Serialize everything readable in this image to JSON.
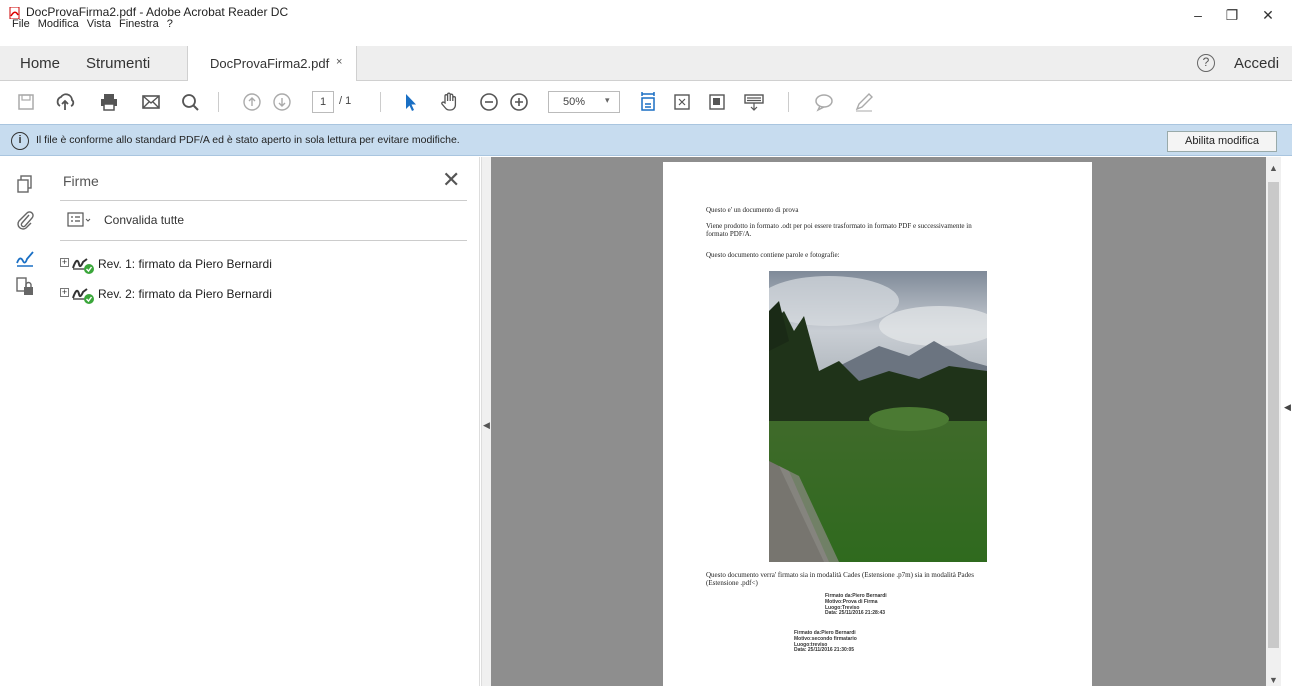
{
  "window": {
    "title": "DocProvaFirma2.pdf - Adobe Acrobat Reader DC",
    "menu": [
      "File",
      "Modifica",
      "Vista",
      "Finestra",
      "?"
    ],
    "minimize_glyph": "–",
    "maximize_glyph": "❐",
    "close_glyph": "✕"
  },
  "tabs": {
    "home": "Home",
    "tools": "Strumenti",
    "document": "DocProvaFirma2.pdf",
    "document_close": "×",
    "help": "?",
    "login": "Accedi"
  },
  "toolbar": {
    "page_current": "1",
    "page_total": "/ 1",
    "zoom": "50%",
    "icons": [
      "save-icon",
      "upload-icon",
      "print-icon",
      "email-icon",
      "search-icon",
      "page-up-icon",
      "page-down-icon",
      "select-cursor-icon",
      "hand-icon",
      "zoom-out-icon",
      "zoom-in-icon",
      "fit-page-icon",
      "full-screen-icon",
      "rotate-icon",
      "keyboard-icon",
      "comment-icon",
      "pen-icon"
    ]
  },
  "infobar": {
    "icon": "i",
    "message": "Il file è conforme allo standard PDF/A ed è stato aperto in sola lettura per evitare modifiche.",
    "button": "Abilita modifica"
  },
  "signatures": {
    "title": "Firme",
    "close": "✕",
    "validate_all": "Convalida tutte",
    "items": [
      {
        "label": "Rev. 1: firmato da Piero Bernardi"
      },
      {
        "label": "Rev. 2: firmato da Piero Bernardi"
      }
    ]
  },
  "document": {
    "line1": "Questo e' un documento di prova",
    "line2": "Viene prodotto in formato .odt per poi essere trasformato in formato PDF e successivamente in",
    "line3": "formato PDF/A.",
    "line4": "Questo documento contiene parole e fotografie:",
    "line5": "Questo documento verra' firmato sia in modalità Cades (Estensione .p7m) sia in modalità Pades",
    "line6": "(Estensione .pdf<)",
    "stamp1": [
      "Firmato da:Piero Bernardi",
      "Motivo:Prova di Firma",
      "Luogo:Treviso",
      "Data: 25/11/2016 21:28:43"
    ],
    "stamp2": [
      "Firmato da:Piero Bernardi",
      "Motivo:secondo firmatario",
      "Luogo:treviso",
      "Data: 25/11/2016 21:30:05"
    ]
  },
  "colors": {
    "infobar_bg": "#c7dcef",
    "tab_bg": "#eeeeee",
    "doc_bg": "#8e8e8e",
    "sig_check": "#3aa63a"
  }
}
